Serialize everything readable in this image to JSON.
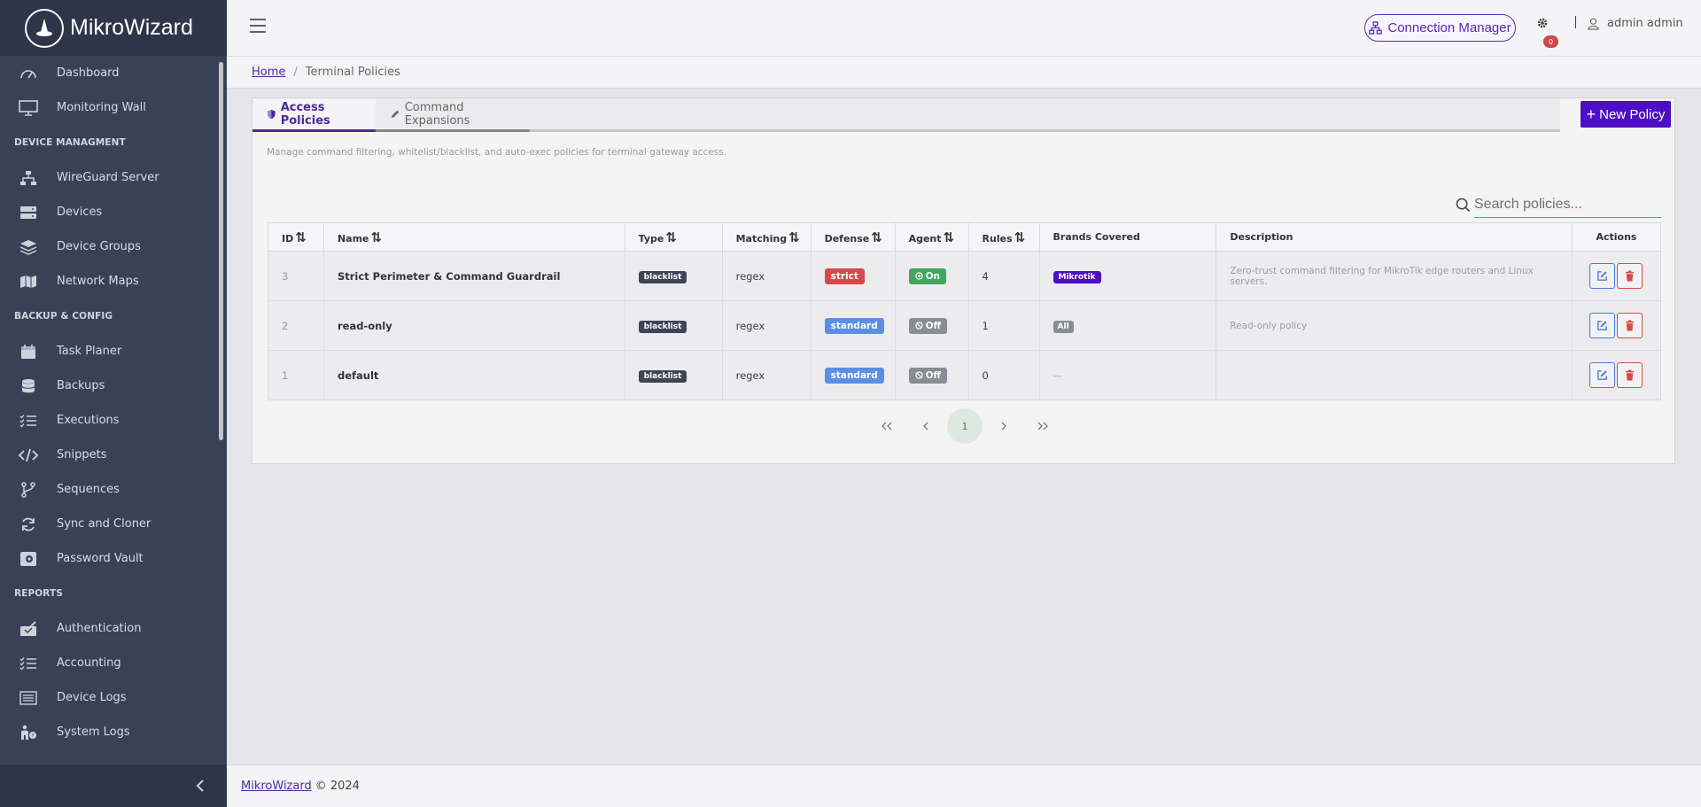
{
  "brand": {
    "name": "MikroWizard"
  },
  "sidebar": {
    "items": [
      {
        "type": "item",
        "label": "Dashboard",
        "icon": "speedometer-icon",
        "name": "sidebar-item-dashboard"
      },
      {
        "type": "item",
        "label": "Monitoring Wall",
        "icon": "monitor-icon",
        "name": "sidebar-item-monitoring-wall"
      },
      {
        "type": "section",
        "label": "DEVICE MANAGMENT",
        "name": "section-device-management"
      },
      {
        "type": "item",
        "label": "WireGuard Server",
        "icon": "network-icon",
        "name": "sidebar-item-wireguard-server"
      },
      {
        "type": "item",
        "label": "Devices",
        "icon": "server-icon",
        "name": "sidebar-item-devices"
      },
      {
        "type": "item",
        "label": "Device Groups",
        "icon": "layers-icon",
        "name": "sidebar-item-device-groups"
      },
      {
        "type": "item",
        "label": "Network Maps",
        "icon": "map-icon",
        "name": "sidebar-item-network-maps"
      },
      {
        "type": "section",
        "label": "BACKUP & CONFIG",
        "name": "section-backup-config"
      },
      {
        "type": "item",
        "label": "Task Planer",
        "icon": "calendar-icon",
        "name": "sidebar-item-task-planer"
      },
      {
        "type": "item",
        "label": "Backups",
        "icon": "database-icon",
        "name": "sidebar-item-backups"
      },
      {
        "type": "item",
        "label": "Executions",
        "icon": "checklist-icon",
        "name": "sidebar-item-executions"
      },
      {
        "type": "item",
        "label": "Snippets",
        "icon": "code-icon",
        "name": "sidebar-item-snippets"
      },
      {
        "type": "item",
        "label": "Sequences",
        "icon": "branch-icon",
        "name": "sidebar-item-sequences"
      },
      {
        "type": "item",
        "label": "Sync and Cloner",
        "icon": "sync-icon",
        "name": "sidebar-item-sync-and-cloner"
      },
      {
        "type": "item",
        "label": "Password Vault",
        "icon": "vault-icon",
        "name": "sidebar-item-password-vault"
      },
      {
        "type": "section",
        "label": "REPORTS",
        "name": "section-reports"
      },
      {
        "type": "item",
        "label": "Authentication",
        "icon": "auth-check-icon",
        "name": "sidebar-item-authentication"
      },
      {
        "type": "item",
        "label": "Accounting",
        "icon": "checklist-icon",
        "name": "sidebar-item-accounting"
      },
      {
        "type": "item",
        "label": "Device Logs",
        "icon": "list-icon",
        "name": "sidebar-item-device-logs"
      },
      {
        "type": "item",
        "label": "System Logs",
        "icon": "person-question-icon",
        "name": "sidebar-item-system-logs"
      }
    ]
  },
  "header": {
    "connection_manager": "Connection Manager",
    "notification_count": "0",
    "user_name": "admin admin"
  },
  "breadcrumb": {
    "home": "Home",
    "separator": "/",
    "current": "Terminal Policies"
  },
  "tabs": {
    "access": "Access Policies",
    "expansions": "Command Expansions"
  },
  "new_policy_label": "New Policy",
  "description": "Manage command filtering, whitelist/blacklist, and auto-exec policies for terminal gateway access.",
  "search": {
    "placeholder": "Search policies..."
  },
  "table": {
    "headers": {
      "id": "ID",
      "name": "Name",
      "type": "Type",
      "matching": "Matching",
      "defense": "Defense",
      "agent": "Agent",
      "rules": "Rules",
      "brands": "Brands Covered",
      "description": "Description",
      "actions": "Actions"
    },
    "rows": [
      {
        "id": "3",
        "name": "Strict Perimeter & Command Guardrail",
        "type": "blacklist",
        "matching": "regex",
        "defense": "strict",
        "agent": "On",
        "rules": "4",
        "brands": "Mikrotik",
        "description": "Zero-trust command filtering for MikroTik edge routers and Linux servers."
      },
      {
        "id": "2",
        "name": "read-only",
        "type": "blacklist",
        "matching": "regex",
        "defense": "standard",
        "agent": "Off",
        "rules": "1",
        "brands": "All",
        "description": "Read-only policy"
      },
      {
        "id": "1",
        "name": "default",
        "type": "blacklist",
        "matching": "regex",
        "defense": "standard",
        "agent": "Off",
        "rules": "0",
        "brands": "—",
        "description": ""
      }
    ]
  },
  "pagination": {
    "first": "«",
    "prev": "‹",
    "current": "1",
    "next": "›",
    "last": "»"
  },
  "footer": {
    "link": "MikroWizard",
    "text": "© 2024"
  },
  "colors": {
    "accent": "#4e0ec6",
    "sidebar": "#3a4157",
    "strict": "#d44a48",
    "standard": "#5b8fe6",
    "on": "#3fa85d",
    "off": "#8a8c94"
  }
}
